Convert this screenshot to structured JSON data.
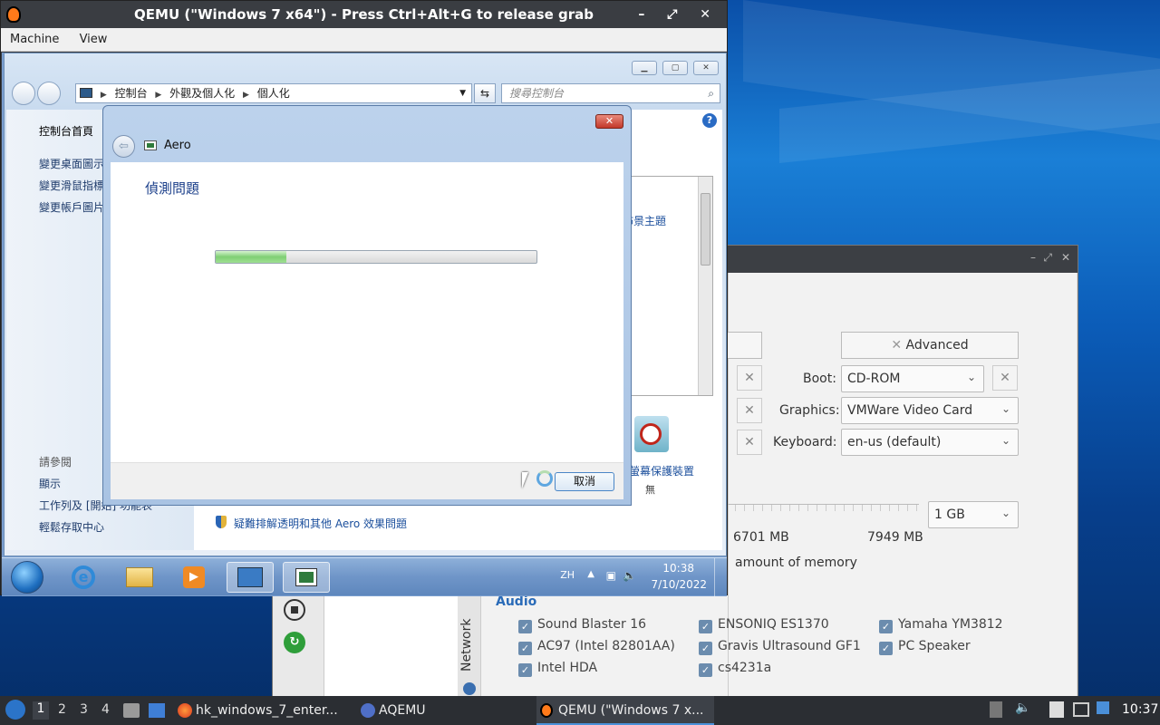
{
  "qemu": {
    "title": "QEMU (\"Windows 7 x64\") - Press Ctrl+Alt+G to release grab",
    "controls": "– ⤢ ✕",
    "menu": [
      "Machine",
      "View"
    ]
  },
  "explorer": {
    "breadcrumb": [
      "控制台",
      "外觀及個人化",
      "個人化"
    ],
    "search_placeholder": "搜尋控制台",
    "left_links": [
      "控制台首頁",
      "變更桌面圖示",
      "變更滑鼠指標",
      "變更帳戶圖片"
    ],
    "see_also_heading": "請參閱",
    "see_also": [
      "顯示",
      "工作列及 [開始] 功能表",
      "輕鬆存取中心"
    ],
    "theme_link_partial": "佈景主題",
    "screensaver_label": "螢幕保護裝置",
    "screensaver_value": "無",
    "troubleshoot_link": "疑難排解透明和其他 Aero 效果問題"
  },
  "dialog": {
    "title": "Aero",
    "heading": "偵測問題",
    "progress": 0.22,
    "cancel_label": "取消"
  },
  "guest_taskbar": {
    "lang": "ZH",
    "time": "10:38",
    "date": "7/10/2022"
  },
  "aqemu": {
    "advanced_label": "Advanced",
    "boot_label": "Boot:",
    "boot_value": "CD-ROM",
    "graphics_label": "Graphics:",
    "graphics_value": "VMWare Video Card",
    "keyboard_label": "Keyboard:",
    "keyboard_value": "en-us (default)",
    "memory_value": "1 GB",
    "mem_free": "6701 MB",
    "mem_total": "7949 MB",
    "memory_note": "amount of memory",
    "audio_heading": "Audio",
    "audio_cards": [
      [
        "Sound Blaster 16",
        "ENSONIQ ES1370",
        "Yamaha YM3812"
      ],
      [
        "AC97 (Intel 82801AA)",
        "Gravis Ultrasound GF1",
        "PC Speaker"
      ],
      [
        "Intel HDA",
        "cs4231a",
        ""
      ]
    ],
    "network_tab": "Network"
  },
  "host_taskbar": {
    "workspaces": [
      "1",
      "2",
      "3",
      "4"
    ],
    "tasks": [
      "hk_windows_7_enter...",
      "AQEMU",
      "QEMU (\"Windows 7 x..."
    ],
    "time": "10:37"
  }
}
